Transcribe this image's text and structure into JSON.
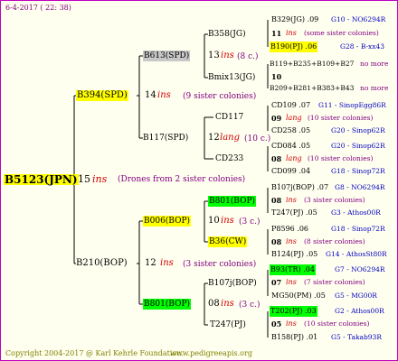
{
  "header": {
    "date": "6-4-2017 ( 22: 38)"
  },
  "footer": {
    "copyright": "Copyright 2004-2017 @ Karl Kehrle Foundation.",
    "site": "www.pedigreeapis.org"
  },
  "colors": {
    "queen_yellow": "#ffff00",
    "queen_grey": "#c8c8c8",
    "queen_green": "#00ff00",
    "ins": "#d00000",
    "colony": "#800080",
    "breeder": "#0000c0"
  },
  "root": {
    "name": "B5123(JPN)",
    "num": "15",
    "ins": "ins",
    "note": "(Drones from 2 sister colonies)"
  },
  "g1": [
    {
      "name": "B394(SPD)",
      "num": "14",
      "ins": "ins",
      "note": "(9 sister colonies)"
    },
    {
      "name": "B210(BOP)",
      "num": "12",
      "ins": "ins",
      "note": "(3 sister colonies)"
    }
  ],
  "g2": [
    {
      "name": "B613(SPD)",
      "num": "13",
      "ins": "ins",
      "note": "(8 c.)"
    },
    {
      "name": "B117(SPD)",
      "num": "12",
      "ins": "lang",
      "note": "(10 c.)"
    },
    {
      "name": "B006(BOP)",
      "num": "10",
      "ins": "ins",
      "note": "(3 c.)"
    },
    {
      "name": "B801(BOP)",
      "num": "08",
      "ins": "ins",
      "note": "(3 c.)"
    }
  ],
  "g3": [
    {
      "name": "B358(JG)"
    },
    {
      "name": "Bmix13(JG)"
    },
    {
      "name": "CD117"
    },
    {
      "name": "CD233"
    },
    {
      "name": "B801(BOP)"
    },
    {
      "name": "B36(CW)"
    },
    {
      "name": "B107j(BOP)"
    },
    {
      "name": "T247(PJ)"
    }
  ],
  "g4": [
    {
      "id": "B329(JG) .09",
      "breeder": "G10 - NO6294R"
    },
    {
      "num": "11",
      "ins": "ins",
      "note": "(some sister colonies)"
    },
    {
      "id": "B190(PJ) .06",
      "breeder": "G28 - B-xx43"
    },
    {
      "id": "B119+B235+B109+B27",
      "breeder": "no more"
    },
    {
      "num": "10"
    },
    {
      "id": "B209+B281+B383+B43",
      "breeder": "no more"
    },
    {
      "id": "CD109 .07",
      "breeder": "G11 - SinopEgg86R"
    },
    {
      "num": "09",
      "ins": "lang",
      "note": "(10 sister colonies)"
    },
    {
      "id": "CD258 .05",
      "breeder": "G20 - Sinop62R"
    },
    {
      "id": "CD084 .05",
      "breeder": "G20 - Sinop62R"
    },
    {
      "num": "08",
      "ins": "lang",
      "note": "(10 sister colonies)"
    },
    {
      "id": "CD099 .04",
      "breeder": "G18 - Sinop72R"
    },
    {
      "id": "B107j(BOP) .07",
      "breeder": "G8 - NO6294R"
    },
    {
      "num": "08",
      "ins": "ins",
      "note": "(3 sister colonies)"
    },
    {
      "id": "T247(PJ) .05",
      "breeder": "G3 - Athos00R"
    },
    {
      "id": "P8596 .06",
      "breeder": "G18 - Sinop72R"
    },
    {
      "num": "08",
      "ins": "ins",
      "note": "(8 sister colonies)"
    },
    {
      "id": "B124(PJ) .05",
      "breeder": "G14 - AthosSt80R"
    },
    {
      "id": "B93(TR) .04",
      "breeder": "G7 - NO6294R"
    },
    {
      "num": "07",
      "ins": "ins",
      "note": "(7 sister colonies)"
    },
    {
      "id": "MG50(PM) .05",
      "breeder": "G5 - MG00R"
    },
    {
      "id": "T202(PJ) .03",
      "breeder": "G2 - Athos00R"
    },
    {
      "num": "05",
      "ins": "ins",
      "note": "(10 sister colonies)"
    },
    {
      "id": "B158(PJ) .01",
      "breeder": "G5 - Takab93R"
    }
  ]
}
